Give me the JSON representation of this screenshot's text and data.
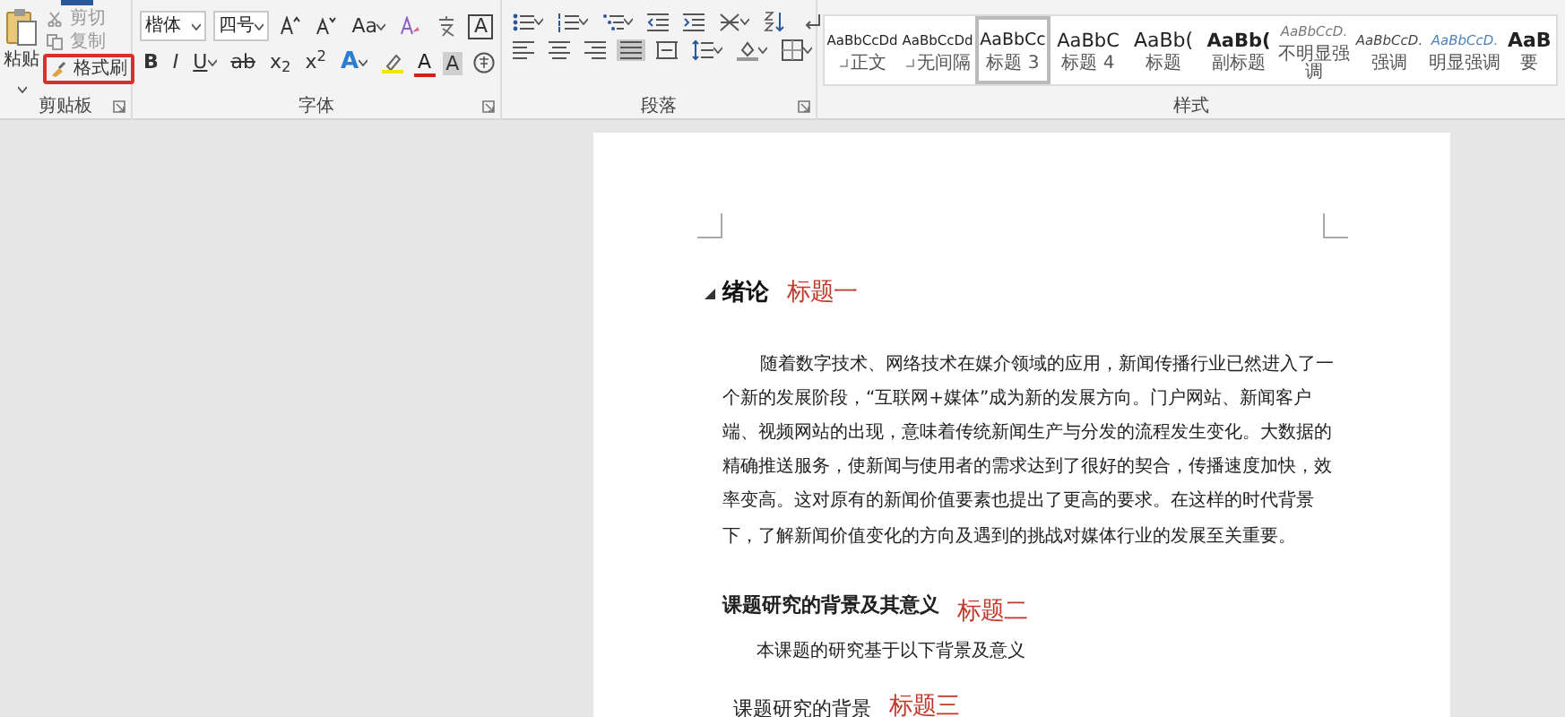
{
  "clipboard": {
    "paste": "粘贴",
    "cut": {
      "label": "剪切",
      "disabled": true
    },
    "copy": {
      "label": "复制",
      "disabled": true
    },
    "format_painter": {
      "label": "格式刷",
      "highlighted": true
    },
    "group_label": "剪贴板"
  },
  "font": {
    "name": "楷体",
    "size": "四号",
    "case_button": "Aa",
    "border_char": "A",
    "bold": "B",
    "italic": "I",
    "underline": "U",
    "strike": "ab",
    "subscript": "x$_{2}$",
    "superscript": "x$^{2}$",
    "text_effect": "A",
    "font_color": "A",
    "shading": "A",
    "group_label": "字体"
  },
  "paragraph": {
    "alignments": [
      {
        "kind": "left",
        "selected": false
      },
      {
        "kind": "center",
        "selected": false
      },
      {
        "kind": "right",
        "selected": false
      },
      {
        "kind": "justify",
        "selected": true
      },
      {
        "kind": "distributed",
        "selected": false
      }
    ],
    "group_label": "段落"
  },
  "styles": {
    "items": [
      {
        "sample": "AaBbCcDd",
        "name": "正文",
        "kind": "plain",
        "paragraph_mark": true,
        "selected": false
      },
      {
        "sample": "AaBbCcDd",
        "name": "无间隔",
        "kind": "plain",
        "paragraph_mark": true,
        "selected": false
      },
      {
        "sample": "AaBbCc",
        "name": "标题 3",
        "kind": "heading",
        "paragraph_mark": false,
        "selected": true
      },
      {
        "sample": "AaBbC",
        "name": "标题 4",
        "kind": "heading-large",
        "paragraph_mark": false,
        "selected": false
      },
      {
        "sample": "AaBb(",
        "name": "标题",
        "kind": "title",
        "paragraph_mark": false,
        "selected": false
      },
      {
        "sample": "AaBb(",
        "name": "副标题",
        "kind": "title-bold",
        "paragraph_mark": false,
        "selected": false
      },
      {
        "sample": "AaBbCcD.",
        "name": "不明显强调",
        "kind": "subtle",
        "paragraph_mark": false,
        "selected": false
      },
      {
        "sample": "AaBbCcD.",
        "name": "强调",
        "kind": "emphasis",
        "paragraph_mark": false,
        "selected": false
      },
      {
        "sample": "AaBbCcD.",
        "name": "明显强调",
        "kind": "intense",
        "paragraph_mark": false,
        "selected": false
      },
      {
        "sample": "AaB",
        "name": "要",
        "kind": "strong",
        "paragraph_mark": false,
        "selected": false
      }
    ],
    "group_label": "样式"
  },
  "document": {
    "blocks": [
      {
        "kind": "h1",
        "text": "绪论",
        "note": "标题一"
      },
      {
        "kind": "para",
        "text": "随着数字技术、网络技术在媒介领域的应用，新闻传播行业已然进入了一个新的发展阶段，“互联网+媒体”成为新的发展方向。门户网站、新闻客户端、视频网站的出现，意味着传统新闻生产与分发的流程发生变化。大数据的精确推送服务，使新闻与使用者的需求达到了很好的契合，传播速度加快，效率变高。这对原有的新闻价值要素也提出了更高的要求。在这样的时代背景下，了解新闻价值变化的方向及遇到的挑战对媒体行业的发展至关重要。"
      },
      {
        "kind": "h2",
        "text": "课题研究的背景及其意义",
        "note": "标题二"
      },
      {
        "kind": "body",
        "text": "本课题的研究基于以下背景及意义"
      },
      {
        "kind": "h3",
        "text": "课题研究的背景",
        "note": "标题三"
      }
    ]
  }
}
